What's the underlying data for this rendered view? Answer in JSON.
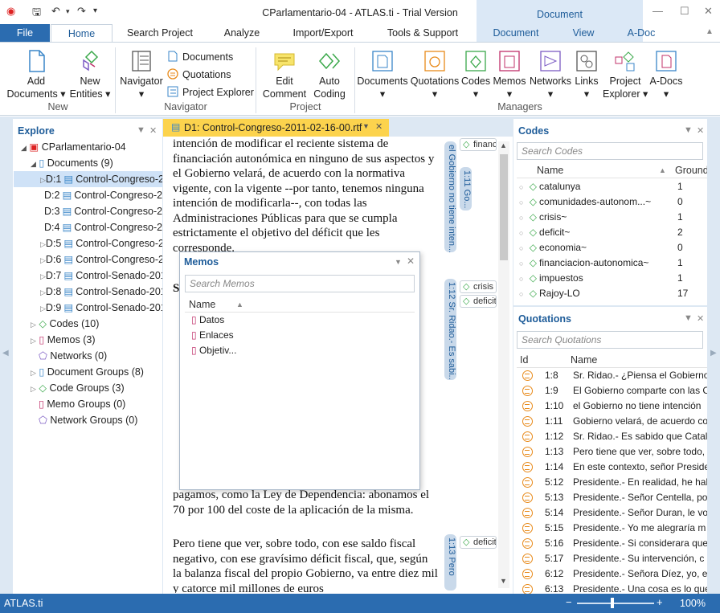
{
  "app": {
    "title": "CParlamentario-04 - ATLAS.ti - Trial Version",
    "context_tab_group": "Document"
  },
  "tabs": {
    "file": "File",
    "home": "Home",
    "search": "Search Project",
    "analyze": "Analyze",
    "import": "Import/Export",
    "tools": "Tools & Support",
    "document": "Document",
    "view": "View",
    "adoc": "A-Doc"
  },
  "ribbon": {
    "add_documents": "Add\nDocuments ▾",
    "new_entities": "New\nEntities ▾",
    "group_new": "New",
    "navigator": "Navigator\n▾",
    "documents": "Documents",
    "quotations": "Quotations",
    "project_explorer": "Project Explorer",
    "group_navigator": "Navigator",
    "edit_comment": "Edit\nComment",
    "auto_coding": "Auto\nCoding",
    "group_project": "Project",
    "m_documents": "Documents\n▾",
    "m_quotations": "Quotations\n▾",
    "m_codes": "Codes\n▾",
    "m_memos": "Memos\n▾",
    "m_networks": "Networks\n▾",
    "m_links": "Links\n▾",
    "m_project_explorer": "Project\nExplorer ▾",
    "m_adocs": "A-Docs\n▾",
    "group_managers": "Managers"
  },
  "explore": {
    "title": "Explore",
    "root": "CParlamentario-04",
    "documents": "Documents (9)",
    "docs": [
      "D:1",
      "D:2",
      "D:3",
      "D:4",
      "D:5",
      "D:6",
      "D:7",
      "D:8",
      "D:9"
    ],
    "doc_names": [
      "Control-Congreso-2",
      "Control-Congreso-2",
      "Control-Congreso-2",
      "Control-Congreso-2",
      "Control-Congreso-2",
      "Control-Congreso-2",
      "Control-Senado-201",
      "Control-Senado-201",
      "Control-Senado-201"
    ],
    "codes": "Codes (10)",
    "memos": "Memos (3)",
    "networks": "Networks (0)",
    "doc_groups": "Document Groups (8)",
    "code_groups": "Code Groups (3)",
    "memo_groups": "Memo Groups (0)",
    "network_groups": "Network Groups (0)"
  },
  "document": {
    "tab_label": "D1: Control-Congreso-2011-02-16-00.rtf",
    "para1": "intención de modificar el reciente sistema de financiación autonómica en ninguno de sus aspectos y el Gobierno velará, de acuerdo con la normativa vigente, con la vigente --por tanto, tenemos ninguna intención de modificarla--, con todas las Administraciones Públicas para que se cumpla estrictamente el objetivo del déficit que les corresponde.",
    "para2_tail": "pagamos, como la Ley de Dependencia: abonamos el 70 por 100 del coste de la aplicación de la misma.",
    "para3": "Pero tiene que ver, sobre todo, con ese saldo fiscal negativo, con ese gravísimo déficit fiscal, que, según la balanza fiscal del propio Gobierno, va entre diez mil y catorce mil millones de euros",
    "margin": [
      {
        "label": "el Gobierno no tiene inten..."
      },
      {
        "label": "1:11 Go..."
      },
      {
        "label": "1:12 Sr. Ridao.- Es sabi..."
      },
      {
        "label": "1:13 Pero"
      }
    ],
    "tags": [
      "financ",
      "crisis",
      "deficit",
      "deficit"
    ]
  },
  "memos_popup": {
    "title": "Memos",
    "search_placeholder": "Search Memos",
    "col_name": "Name",
    "items": [
      "Datos",
      "Enlaces",
      "Objetiv..."
    ]
  },
  "codes": {
    "title": "Codes",
    "search_placeholder": "Search Codes",
    "col_name": "Name",
    "col_grounded": "Grounded",
    "items": [
      {
        "name": "catalunya",
        "g": "1"
      },
      {
        "name": "comunidades-autonom...~",
        "g": "0"
      },
      {
        "name": "crisis~",
        "g": "1"
      },
      {
        "name": "deficit~",
        "g": "2"
      },
      {
        "name": "economia~",
        "g": "0"
      },
      {
        "name": "financiacion-autonomica~",
        "g": "1"
      },
      {
        "name": "impuestos",
        "g": "1"
      },
      {
        "name": "Rajoy-LO",
        "g": "17"
      }
    ]
  },
  "quotations": {
    "title": "Quotations",
    "search_placeholder": "Search Quotations",
    "col_id": "Id",
    "col_name": "Name",
    "items": [
      {
        "id": "1:8",
        "name": "Sr. Ridao.- ¿Piensa el Gobierno"
      },
      {
        "id": "1:9",
        "name": "El Gobierno comparte con las C"
      },
      {
        "id": "1:10",
        "name": "el Gobierno no tiene intención"
      },
      {
        "id": "1:11",
        "name": "Gobierno velará, de acuerdo co"
      },
      {
        "id": "1:12",
        "name": "Sr. Ridao.- Es sabido que Catalu"
      },
      {
        "id": "1:13",
        "name": "Pero tiene que ver, sobre todo,"
      },
      {
        "id": "1:14",
        "name": "En este contexto, señor Preside"
      },
      {
        "id": "5:12",
        "name": "Presidente.- En realidad, he hab"
      },
      {
        "id": "5:13",
        "name": "Presidente.- Señor Centella, po"
      },
      {
        "id": "5:14",
        "name": "Presidente.- Señor Duran, le vo"
      },
      {
        "id": "5:15",
        "name": "Presidente.- Yo me alegraría m"
      },
      {
        "id": "5:16",
        "name": "Presidente.- Si considerara que"
      },
      {
        "id": "5:17",
        "name": "Presidente.- Su intervención, c"
      },
      {
        "id": "6:12",
        "name": "Presidente.- Señora Díez, yo, er"
      },
      {
        "id": "6:13",
        "name": "Presidente.- Una cosa es lo que"
      }
    ]
  },
  "status": {
    "app": "ATLAS.ti",
    "zoom": "100%"
  },
  "colors": {
    "accent": "#2b6cb0",
    "doc_tab": "#fcd34d",
    "code_green": "#3aa84a",
    "memo_pink": "#c0306a"
  }
}
